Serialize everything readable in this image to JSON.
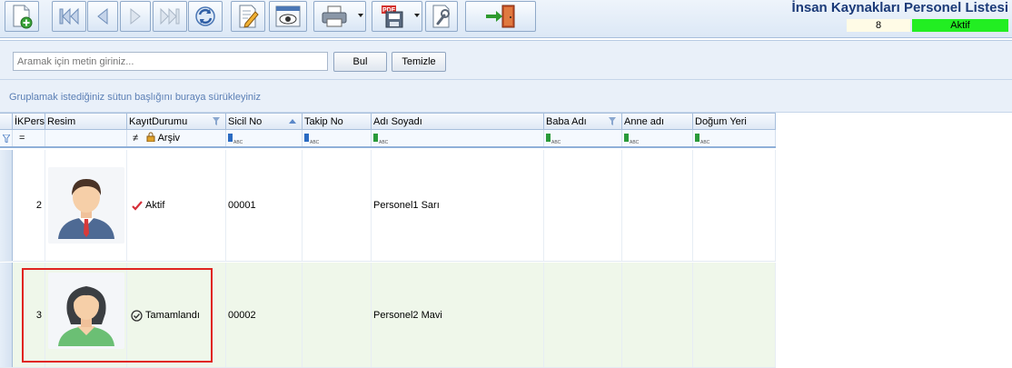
{
  "window": {
    "title": "İnsan Kaynakları Personel Listesi",
    "record_count": "8",
    "status": "Aktif",
    "status_color": "#22ee22"
  },
  "toolbar": {
    "buttons": [
      {
        "name": "new-record",
        "icon": "new-document-icon"
      },
      {
        "name": "first-record",
        "icon": "first-record-icon"
      },
      {
        "name": "previous-record",
        "icon": "previous-record-icon"
      },
      {
        "name": "next-record",
        "icon": "next-record-icon"
      },
      {
        "name": "last-record",
        "icon": "last-record-icon"
      },
      {
        "name": "refresh",
        "icon": "refresh-icon"
      },
      {
        "name": "edit",
        "icon": "edit-icon"
      },
      {
        "name": "preview",
        "icon": "preview-icon"
      },
      {
        "name": "print",
        "icon": "printer-icon"
      },
      {
        "name": "export-pdf",
        "icon": "pdf-export-icon",
        "badge": "PDF"
      },
      {
        "name": "settings",
        "icon": "wrench-icon"
      },
      {
        "name": "exit",
        "icon": "exit-door-icon"
      }
    ]
  },
  "search": {
    "placeholder": "Aramak için metin giriniz...",
    "find_label": "Bul",
    "clear_label": "Temizle"
  },
  "group": {
    "hint": "Gruplamak istediğiniz sütun başlığını buraya sürükleyiniz"
  },
  "grid": {
    "columns": [
      {
        "key": "ikpers",
        "label": "İKPers"
      },
      {
        "key": "resim",
        "label": "Resim"
      },
      {
        "key": "kayit",
        "label": "KayıtDurumu"
      },
      {
        "key": "sicil",
        "label": "Sicil No"
      },
      {
        "key": "takip",
        "label": "Takip No"
      },
      {
        "key": "adsoyad",
        "label": "Adı Soyadı"
      },
      {
        "key": "baba",
        "label": "Baba Adı"
      },
      {
        "key": "anne",
        "label": "Anne adı"
      },
      {
        "key": "dogum",
        "label": "Doğum Yeri"
      }
    ],
    "filter": {
      "ikpers_operator": "=",
      "kayit_operator": "≠",
      "kayit_value": "Arşiv",
      "abc_text": "ABC"
    },
    "rows": [
      {
        "ikpers": "2",
        "photo": "male-avatar-icon",
        "status_icon": "checkmark-icon",
        "kayit": "Aktif",
        "sicil": "00001",
        "takip": "",
        "adsoyad": "Personel1 Sarı",
        "baba": "",
        "anne": "",
        "dogum": ""
      },
      {
        "ikpers": "3",
        "photo": "female-avatar-icon",
        "status_icon": "circle-check-icon",
        "kayit": "Tamamlandı",
        "sicil": "00002",
        "takip": "",
        "adsoyad": "Personel2 Mavi",
        "baba": "",
        "anne": "",
        "dogum": ""
      }
    ]
  },
  "colors": {
    "title": "#1b3a78",
    "highlight": "#e0241f",
    "selected_row": "#eff7ea"
  }
}
